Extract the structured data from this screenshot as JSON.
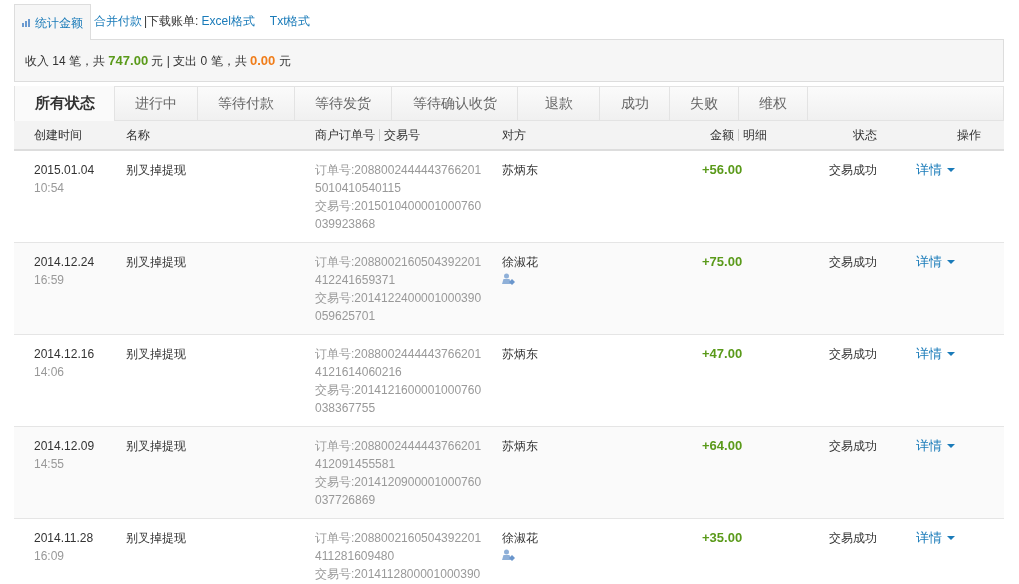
{
  "toolbar": {
    "tabs": [
      {
        "label": "统计金额",
        "selected": true
      }
    ],
    "links": [
      {
        "kind": "link",
        "text": "合并付款"
      },
      {
        "kind": "text",
        "text": "|下载账单:"
      },
      {
        "kind": "link",
        "text": "Excel格式"
      },
      {
        "kind": "link",
        "text": "Txt格式"
      }
    ]
  },
  "summary": [
    {
      "kind": "text",
      "text": "收入 14 笔，共"
    },
    {
      "kind": "income",
      "text": "747.00"
    },
    {
      "kind": "text",
      "text": "元 | 支出 0 笔，共"
    },
    {
      "kind": "expense",
      "text": "0.00"
    },
    {
      "kind": "text",
      "text": "元"
    }
  ],
  "status_tabs": [
    {
      "label": "所有状态",
      "selected": true
    },
    {
      "label": "进行中",
      "selected": false
    },
    {
      "label": "等待付款",
      "selected": false
    },
    {
      "label": "等待发货",
      "selected": false
    },
    {
      "label": "等待确认收货",
      "selected": false
    },
    {
      "label": "退款",
      "selected": false
    },
    {
      "label": "成功",
      "selected": false
    },
    {
      "label": "失败",
      "selected": false
    },
    {
      "label": "维权",
      "selected": false
    }
  ],
  "table": {
    "columns": [
      "创建时间",
      "名称",
      "商户订单号",
      "交易号",
      "对方",
      "金额",
      "明细",
      "状态",
      "操作"
    ],
    "rows": [
      {
        "date": "2015.01.04",
        "time": "10:54",
        "name": "别叉掉提现",
        "order_no": "订单号:20880024444437662015010410540115",
        "trade_no": "交易号:2015010400001000760039923868",
        "party": "苏炳东",
        "party_badge": false,
        "amount": "+56.00",
        "status": "交易成功",
        "action": "详情"
      },
      {
        "date": "2014.12.24",
        "time": "16:59",
        "name": "别叉掉提现",
        "order_no": "订单号:2088002160504392201412241659371",
        "trade_no": "交易号:2014122400001000390059625701",
        "party": "徐淑花",
        "party_badge": true,
        "amount": "+75.00",
        "status": "交易成功",
        "action": "详情"
      },
      {
        "date": "2014.12.16",
        "time": "14:06",
        "name": "别叉掉提现",
        "order_no": "订单号:20880024444437662014121614060216",
        "trade_no": "交易号:2014121600001000760038367755",
        "party": "苏炳东",
        "party_badge": false,
        "amount": "+47.00",
        "status": "交易成功",
        "action": "详情"
      },
      {
        "date": "2014.12.09",
        "time": "14:55",
        "name": "别叉掉提现",
        "order_no": "订单号:2088002444443766201412091455581",
        "trade_no": "交易号:2014120900001000760037726869",
        "party": "苏炳东",
        "party_badge": false,
        "amount": "+64.00",
        "status": "交易成功",
        "action": "详情"
      },
      {
        "date": "2014.11.28",
        "time": "16:09",
        "name": "别叉掉提现",
        "order_no": "订单号:2088002160504392201411281609480",
        "trade_no": "交易号:2014112800001000390",
        "party": "徐淑花",
        "party_badge": true,
        "amount": "+35.00",
        "status": "交易成功",
        "action": "详情"
      }
    ]
  }
}
